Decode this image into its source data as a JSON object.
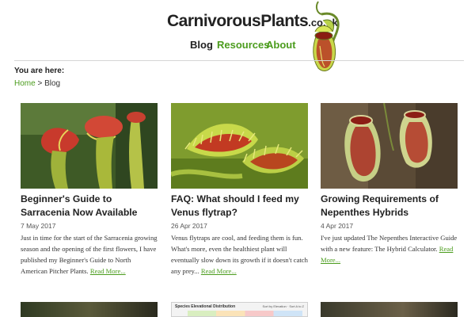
{
  "site": {
    "name": "CarnivorousPlants",
    "tld": ".co.uk"
  },
  "nav": {
    "blog": "Blog",
    "resources": "Resources",
    "about": "About"
  },
  "breadcrumb": {
    "heading": "You are here:",
    "home": "Home",
    "separator": ">",
    "current": "Blog"
  },
  "posts": [
    {
      "title": "Beginner's Guide to Sarracenia Now Available",
      "date": "7 May 2017",
      "excerpt": "Just in time for the start of the Sarracenia growing season and the opening of the first flowers, I have published my Beginner's Guide to North American Pitcher Plants.",
      "read_more": "Read More..."
    },
    {
      "title": "FAQ: What should I feed my Venus flytrap?",
      "date": "26 Apr 2017",
      "excerpt": "Venus flytraps are cool, and feeding them is fun. What's more, even the healthiest plant will eventually slow down its growth if it doesn't catch any prey...",
      "read_more": "Read More..."
    },
    {
      "title": "Growing Requirements of Nepenthes Hybrids",
      "date": "4 Apr 2017",
      "excerpt": "I've just updated The Nepenthes Interactive Guide with a new feature: The Hybrid Calculator.",
      "read_more": "Read More..."
    }
  ],
  "second_row": {
    "chart_title": "Species Elevational Distribution",
    "chart_subtitle": "Sort by Elevation · Sort A to Z"
  },
  "colors": {
    "accent": "#4b9c1d",
    "text": "#222222",
    "rule": "#d6d6d6"
  }
}
